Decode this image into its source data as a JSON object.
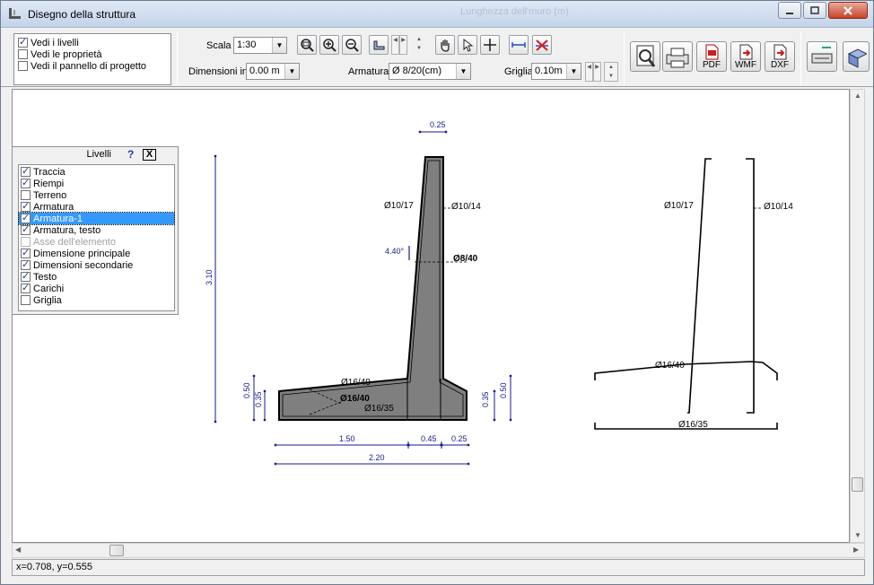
{
  "window": {
    "title": "Disegno della struttura",
    "background_labels": [
      "Lunghezza dell'muro (m)"
    ]
  },
  "view_options": [
    {
      "label": "Vedi i livelli",
      "checked": true
    },
    {
      "label": "Vedi le proprietà",
      "checked": false
    },
    {
      "label": "Vedi il pannello di progetto",
      "checked": false
    }
  ],
  "toolbar": {
    "scale_label": "Scala",
    "scale_value": "1:30",
    "dimensions_label": "Dimensioni in",
    "dimensions_value": "0.00 m",
    "rebar_label": "Armatura",
    "rebar_value": "Ø 8/20(cm)",
    "grid_label": "Griglia",
    "grid_value": "0.10m",
    "export_pdf": "PDF",
    "export_wmf": "WMF",
    "export_dxf": "DXF"
  },
  "layers": {
    "title": "Livelli",
    "help": "?",
    "close": "X",
    "items": [
      {
        "label": "Traccia",
        "checked": true,
        "selected": false,
        "disabled": false
      },
      {
        "label": "Riempi",
        "checked": true,
        "selected": false,
        "disabled": false
      },
      {
        "label": "Terreno",
        "checked": false,
        "selected": false,
        "disabled": false
      },
      {
        "label": "Armatura",
        "checked": true,
        "selected": false,
        "disabled": false
      },
      {
        "label": "Armatura-1",
        "checked": true,
        "selected": true,
        "disabled": false
      },
      {
        "label": "Armatura, testo",
        "checked": true,
        "selected": false,
        "disabled": false
      },
      {
        "label": "Asse dell'elemento",
        "checked": false,
        "selected": false,
        "disabled": true
      },
      {
        "label": "Dimensione principale",
        "checked": true,
        "selected": false,
        "disabled": false
      },
      {
        "label": "Dimensioni secondarie",
        "checked": true,
        "selected": false,
        "disabled": false
      },
      {
        "label": "Testo",
        "checked": true,
        "selected": false,
        "disabled": false
      },
      {
        "label": "Carichi",
        "checked": true,
        "selected": false,
        "disabled": false
      },
      {
        "label": "Griglia",
        "checked": false,
        "selected": false,
        "disabled": false
      }
    ]
  },
  "drawing": {
    "dim_top": "0.25",
    "dim_height": "3.10",
    "dim_base_left": "0.50",
    "dim_toe": "0.35",
    "dim_heel": "0.35",
    "dim_base_right": "0.50",
    "dim_b1": "1.50",
    "dim_b2": "0.45",
    "dim_b3": "0.25",
    "dim_total": "2.20",
    "angle": "4.40°",
    "bar_front": "Ø10/17",
    "bar_back": "Ø10/14",
    "bar_dist": "Ø8/40",
    "bar_base_top": "Ø16/40",
    "bar_base_mid": "Ø16/40",
    "bar_base_bot": "Ø16/35",
    "detail_front": "Ø10/17",
    "detail_back": "Ø10/14",
    "detail_top": "Ø16/40",
    "detail_bot": "Ø16/35"
  },
  "status": {
    "coords": "x=0.708, y=0.555"
  },
  "colors": {
    "dimension": "#1a1a8c",
    "wall_fill": "#7f7f7f",
    "selection": "#3399ff"
  }
}
